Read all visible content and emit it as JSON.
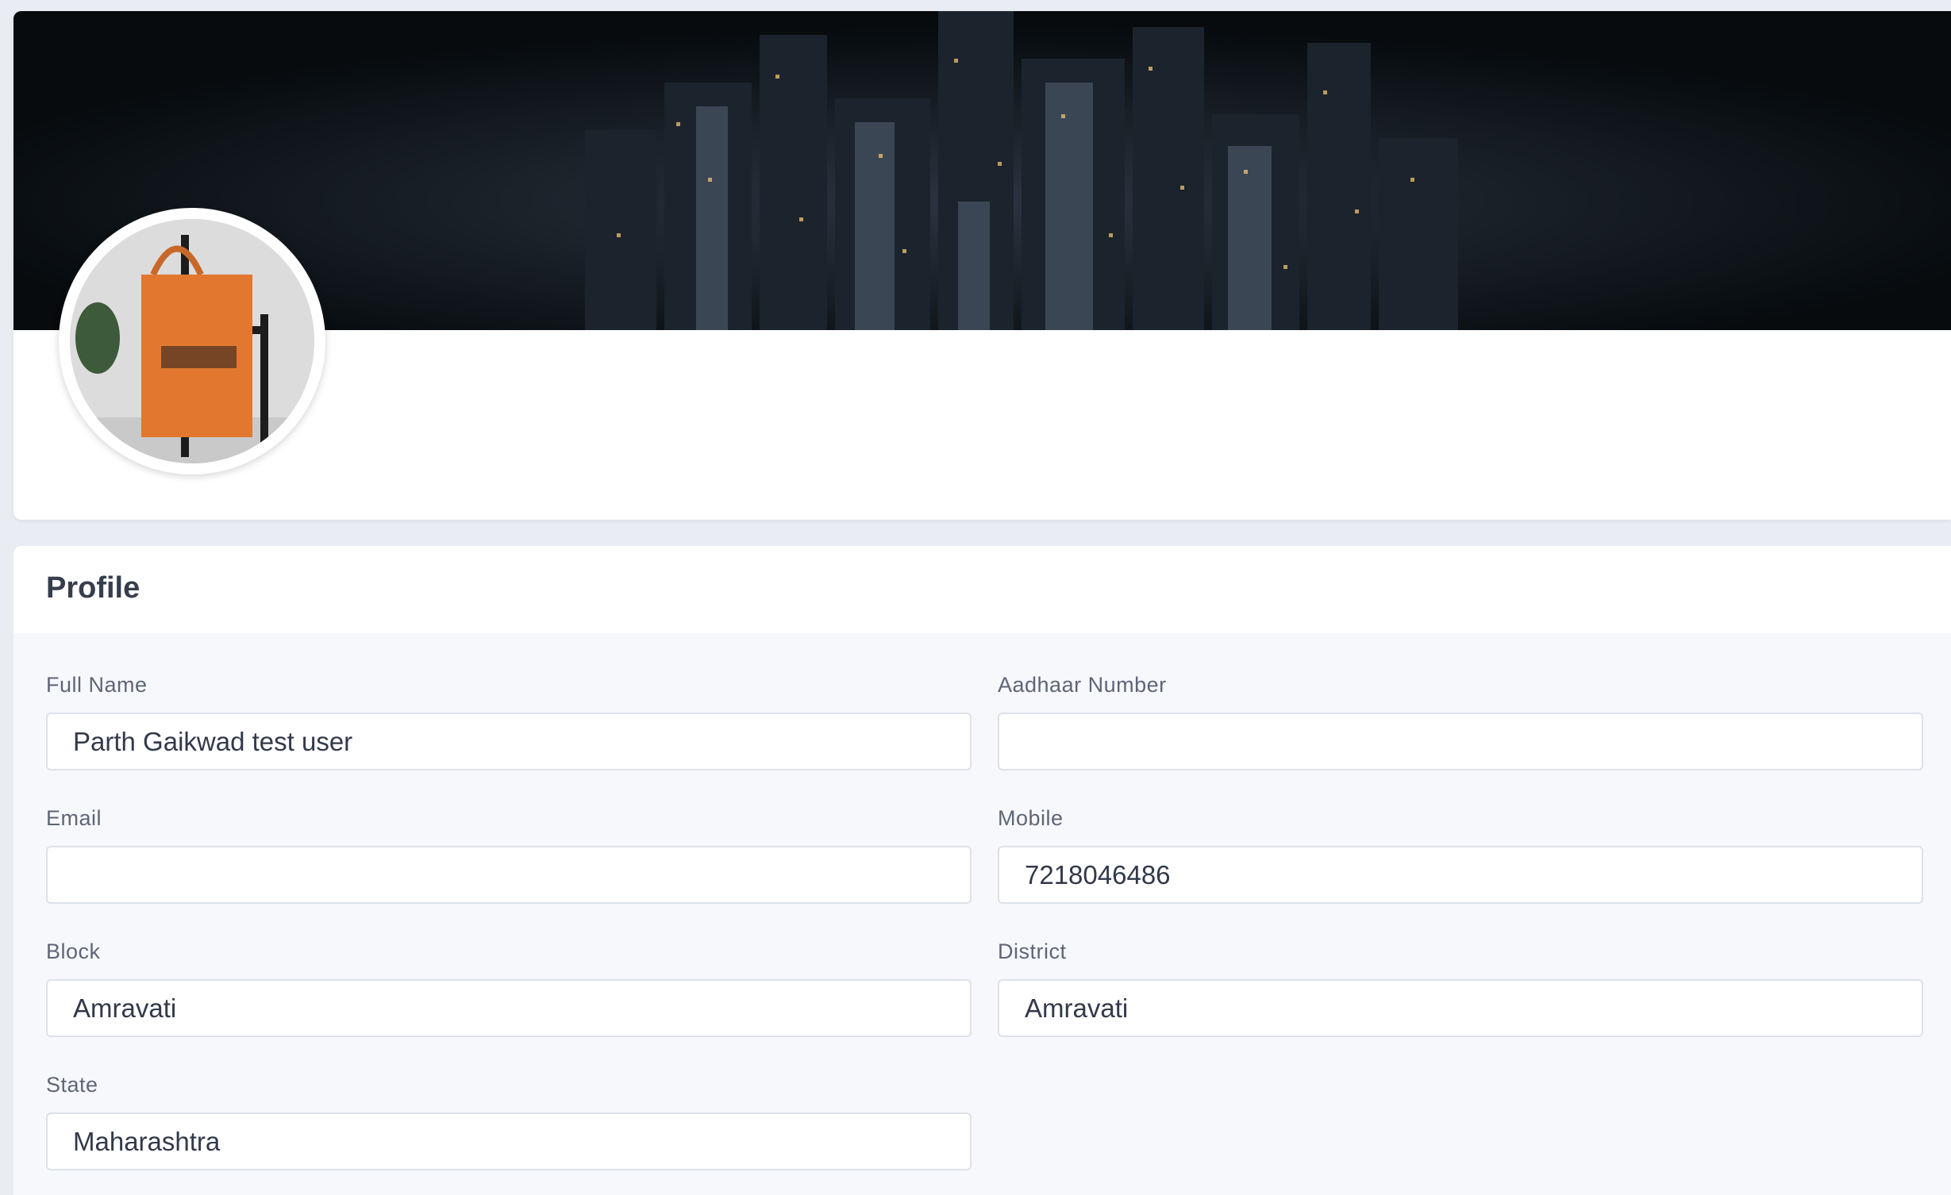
{
  "cover": {
    "image_icon": "city-skyline-night-image",
    "avatar_icon": "orange-tote-bag-avatar"
  },
  "profile": {
    "title": "Profile",
    "fields": {
      "full_name": {
        "label": "Full Name",
        "value": "Parth Gaikwad test user"
      },
      "aadhaar": {
        "label": "Aadhaar Number",
        "value": ""
      },
      "email": {
        "label": "Email",
        "value": ""
      },
      "mobile": {
        "label": "Mobile",
        "value": "7218046486"
      },
      "block": {
        "label": "Block",
        "value": "Amravati"
      },
      "district": {
        "label": "District",
        "value": "Amravati"
      },
      "state": {
        "label": "State",
        "value": "Maharashtra"
      }
    }
  },
  "colors": {
    "page_bg": "#e9ecf2",
    "card_bg": "#ffffff",
    "form_bg": "#f6f8fb",
    "input_border": "#dde1ea",
    "avatar_bag": "#e2782f"
  }
}
